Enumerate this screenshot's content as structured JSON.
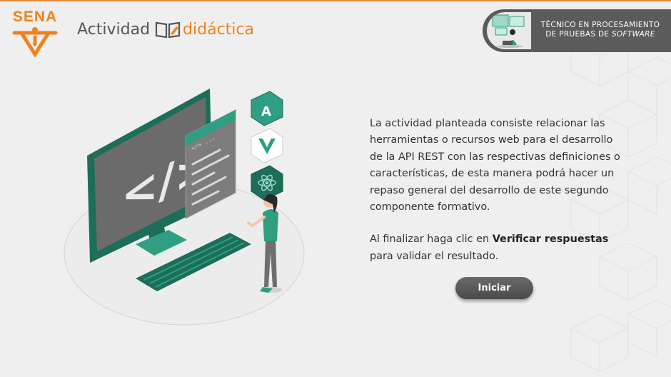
{
  "header": {
    "logo_text": "SENA",
    "title_part1": "Actividad",
    "title_part2": "didáctica",
    "badge_line1": "TÉCNICO EN PROCESAMIENTO",
    "badge_line2_prefix": "DE PRUEBAS DE ",
    "badge_line2_italic": "SOFTWARE"
  },
  "illustration": {
    "code_symbol": "</>",
    "code_header": "</> ...",
    "framework_icons": [
      "angular-icon",
      "vue-icon",
      "react-icon"
    ]
  },
  "content": {
    "paragraph1": "La actividad planteada consiste relacionar las herramientas o recursos web para el desarrollo de la API REST con las respectivas definiciones o características, de esta manera podrá hacer un repaso general del desarrollo de este segundo componente formativo.",
    "paragraph2_prefix": "Al finalizar haga clic en ",
    "paragraph2_bold": "Verificar respuestas",
    "paragraph2_suffix": " para validar el resultado."
  },
  "actions": {
    "start_label": "Iniciar"
  },
  "colors": {
    "brand_orange": "#f0821e",
    "teal": "#2f9e82",
    "dark_teal": "#1c6e5a",
    "badge_gray": "#5b5b5b"
  }
}
